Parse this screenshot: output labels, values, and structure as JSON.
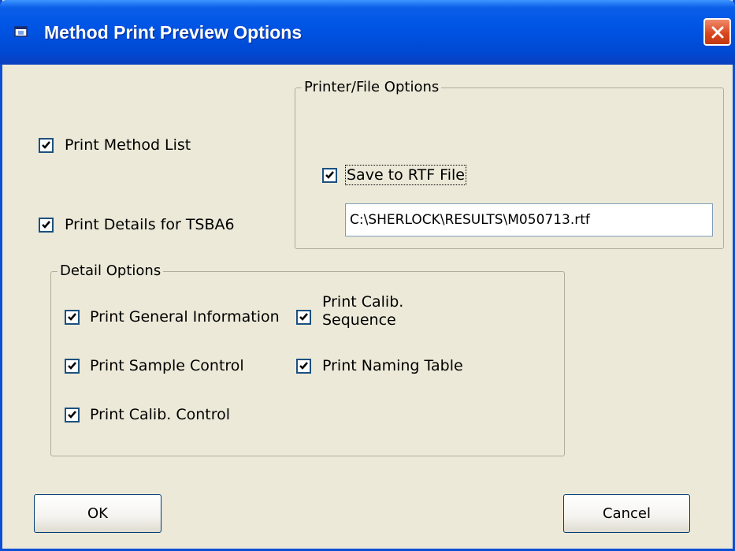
{
  "window": {
    "title": "Method Print Preview Options",
    "accent_color": "#0a5ee8",
    "close_color": "#d8431c"
  },
  "options": {
    "print_method_list": {
      "label": "Print Method List",
      "checked": true
    },
    "print_details": {
      "label": "Print Details for TSBA6",
      "checked": true
    }
  },
  "printer_file_options": {
    "title": "Printer/File Options",
    "save_to_rtf": {
      "label": "Save to RTF File",
      "checked": true
    },
    "file_path": "C:\\SHERLOCK\\RESULTS\\M050713.rtf"
  },
  "detail_options": {
    "title": "Detail Options",
    "general_information": {
      "label": "Print General Information",
      "checked": true
    },
    "sample_control": {
      "label": "Print Sample Control",
      "checked": true
    },
    "calib_control": {
      "label": "Print Calib. Control",
      "checked": true
    },
    "calib_sequence": {
      "label_line1": "Print Calib.",
      "label_line2": "Sequence",
      "checked": true
    },
    "naming_table": {
      "label": "Print Naming Table",
      "checked": true
    }
  },
  "buttons": {
    "ok": "OK",
    "cancel": "Cancel"
  }
}
